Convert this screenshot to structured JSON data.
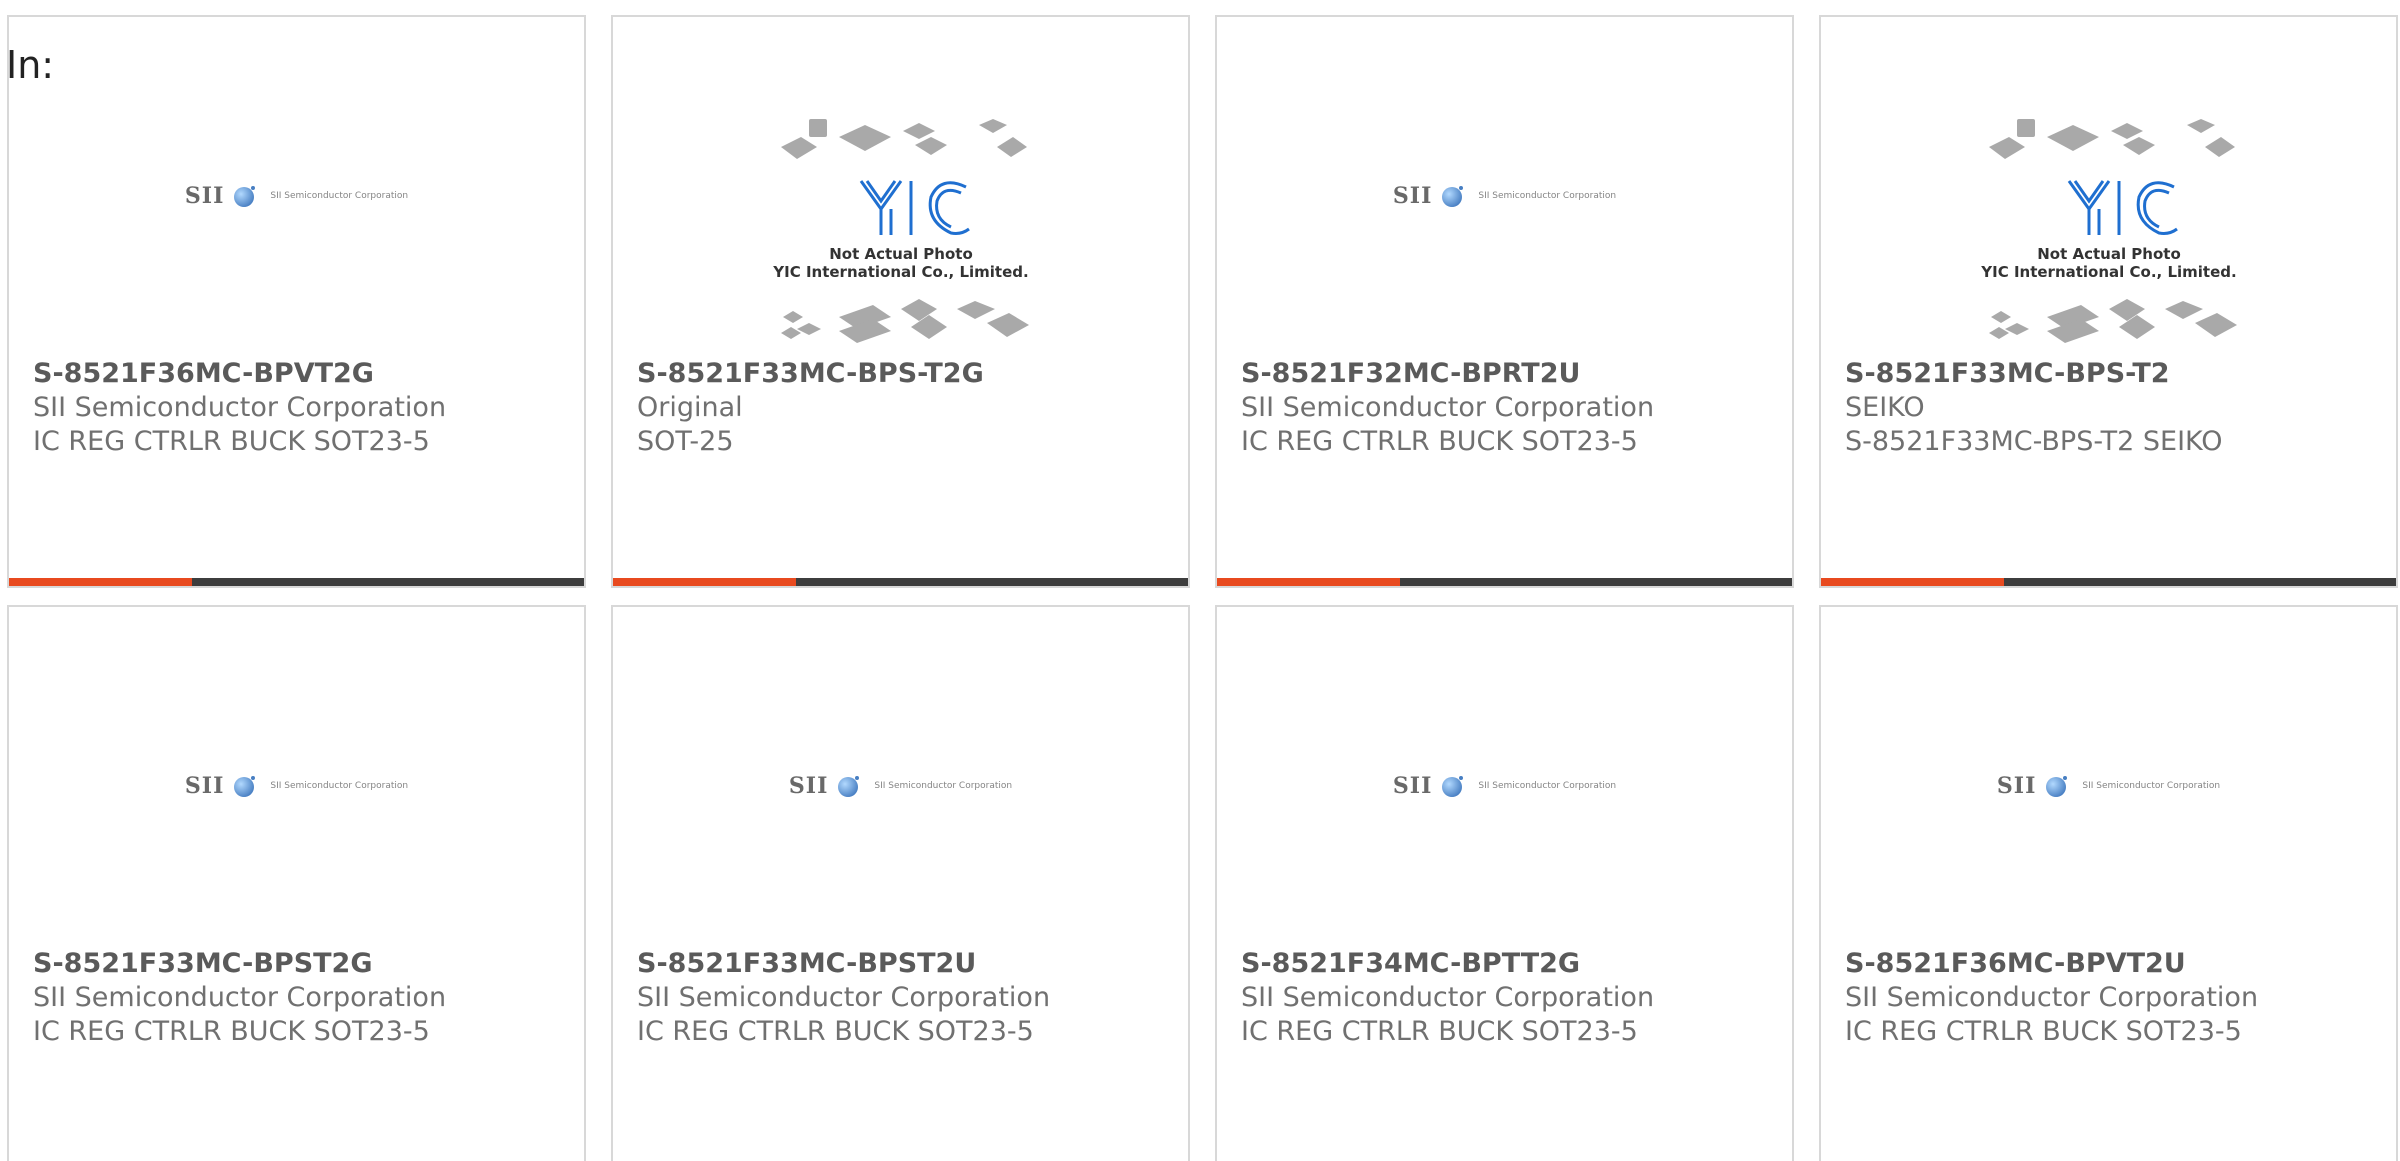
{
  "header": {
    "label": "In:"
  },
  "colors": {
    "accent": "#e84a1f",
    "bar": "#3d3d3d",
    "border": "#d8d8d8"
  },
  "products": [
    {
      "part": "S-8521F36MC-BPVT2G",
      "maker": "SII Semiconductor Corporation",
      "desc": "IC REG CTRLR BUCK SOT23-5",
      "image": "sii-logo"
    },
    {
      "part": "S-8521F33MC-BPS-T2G",
      "maker": "Original",
      "desc": "SOT-25",
      "image": "yic-placeholder"
    },
    {
      "part": "S-8521F32MC-BPRT2U",
      "maker": "SII Semiconductor Corporation",
      "desc": "IC REG CTRLR BUCK SOT23-5",
      "image": "sii-logo"
    },
    {
      "part": "S-8521F33MC-BPS-T2",
      "maker": "SEIKO",
      "desc": "S-8521F33MC-BPS-T2 SEIKO",
      "image": "yic-placeholder"
    },
    {
      "part": "S-8521F33MC-BPST2G",
      "maker": "SII Semiconductor Corporation",
      "desc": "IC REG CTRLR BUCK SOT23-5",
      "image": "sii-logo"
    },
    {
      "part": "S-8521F33MC-BPST2U",
      "maker": "SII Semiconductor Corporation",
      "desc": "IC REG CTRLR BUCK SOT23-5",
      "image": "sii-logo"
    },
    {
      "part": "S-8521F34MC-BPTT2G",
      "maker": "SII Semiconductor Corporation",
      "desc": "IC REG CTRLR BUCK SOT23-5",
      "image": "sii-logo"
    },
    {
      "part": "S-8521F36MC-BPVT2U",
      "maker": "SII Semiconductor Corporation",
      "desc": "IC REG CTRLR BUCK SOT23-5",
      "image": "sii-logo"
    }
  ],
  "logos": {
    "sii": {
      "mark": "SII",
      "sub": "SII Semiconductor Corporation"
    },
    "yic": {
      "mark": "YIC",
      "line1": "Not Actual Photo",
      "line2": "YIC International Co., Limited."
    }
  }
}
